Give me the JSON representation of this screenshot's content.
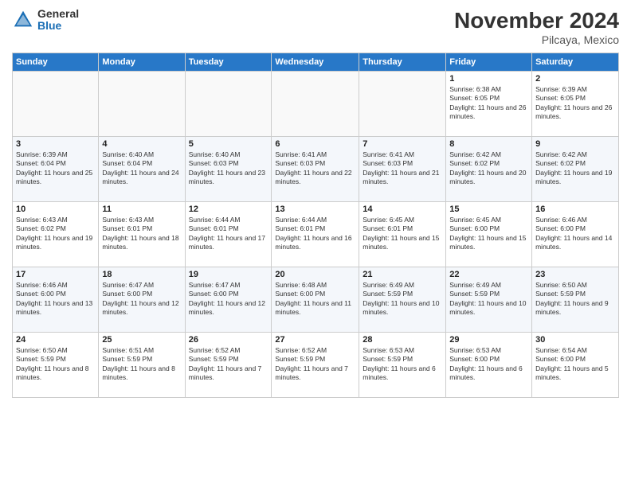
{
  "header": {
    "logo_general": "General",
    "logo_blue": "Blue",
    "month_title": "November 2024",
    "location": "Pilcaya, Mexico"
  },
  "weekdays": [
    "Sunday",
    "Monday",
    "Tuesday",
    "Wednesday",
    "Thursday",
    "Friday",
    "Saturday"
  ],
  "weeks": [
    [
      {
        "day": "",
        "empty": true
      },
      {
        "day": "",
        "empty": true
      },
      {
        "day": "",
        "empty": true
      },
      {
        "day": "",
        "empty": true
      },
      {
        "day": "",
        "empty": true
      },
      {
        "day": "1",
        "sunrise": "Sunrise: 6:38 AM",
        "sunset": "Sunset: 6:05 PM",
        "daylight": "Daylight: 11 hours and 26 minutes."
      },
      {
        "day": "2",
        "sunrise": "Sunrise: 6:39 AM",
        "sunset": "Sunset: 6:05 PM",
        "daylight": "Daylight: 11 hours and 26 minutes."
      }
    ],
    [
      {
        "day": "3",
        "sunrise": "Sunrise: 6:39 AM",
        "sunset": "Sunset: 6:04 PM",
        "daylight": "Daylight: 11 hours and 25 minutes."
      },
      {
        "day": "4",
        "sunrise": "Sunrise: 6:40 AM",
        "sunset": "Sunset: 6:04 PM",
        "daylight": "Daylight: 11 hours and 24 minutes."
      },
      {
        "day": "5",
        "sunrise": "Sunrise: 6:40 AM",
        "sunset": "Sunset: 6:03 PM",
        "daylight": "Daylight: 11 hours and 23 minutes."
      },
      {
        "day": "6",
        "sunrise": "Sunrise: 6:41 AM",
        "sunset": "Sunset: 6:03 PM",
        "daylight": "Daylight: 11 hours and 22 minutes."
      },
      {
        "day": "7",
        "sunrise": "Sunrise: 6:41 AM",
        "sunset": "Sunset: 6:03 PM",
        "daylight": "Daylight: 11 hours and 21 minutes."
      },
      {
        "day": "8",
        "sunrise": "Sunrise: 6:42 AM",
        "sunset": "Sunset: 6:02 PM",
        "daylight": "Daylight: 11 hours and 20 minutes."
      },
      {
        "day": "9",
        "sunrise": "Sunrise: 6:42 AM",
        "sunset": "Sunset: 6:02 PM",
        "daylight": "Daylight: 11 hours and 19 minutes."
      }
    ],
    [
      {
        "day": "10",
        "sunrise": "Sunrise: 6:43 AM",
        "sunset": "Sunset: 6:02 PM",
        "daylight": "Daylight: 11 hours and 19 minutes."
      },
      {
        "day": "11",
        "sunrise": "Sunrise: 6:43 AM",
        "sunset": "Sunset: 6:01 PM",
        "daylight": "Daylight: 11 hours and 18 minutes."
      },
      {
        "day": "12",
        "sunrise": "Sunrise: 6:44 AM",
        "sunset": "Sunset: 6:01 PM",
        "daylight": "Daylight: 11 hours and 17 minutes."
      },
      {
        "day": "13",
        "sunrise": "Sunrise: 6:44 AM",
        "sunset": "Sunset: 6:01 PM",
        "daylight": "Daylight: 11 hours and 16 minutes."
      },
      {
        "day": "14",
        "sunrise": "Sunrise: 6:45 AM",
        "sunset": "Sunset: 6:01 PM",
        "daylight": "Daylight: 11 hours and 15 minutes."
      },
      {
        "day": "15",
        "sunrise": "Sunrise: 6:45 AM",
        "sunset": "Sunset: 6:00 PM",
        "daylight": "Daylight: 11 hours and 15 minutes."
      },
      {
        "day": "16",
        "sunrise": "Sunrise: 6:46 AM",
        "sunset": "Sunset: 6:00 PM",
        "daylight": "Daylight: 11 hours and 14 minutes."
      }
    ],
    [
      {
        "day": "17",
        "sunrise": "Sunrise: 6:46 AM",
        "sunset": "Sunset: 6:00 PM",
        "daylight": "Daylight: 11 hours and 13 minutes."
      },
      {
        "day": "18",
        "sunrise": "Sunrise: 6:47 AM",
        "sunset": "Sunset: 6:00 PM",
        "daylight": "Daylight: 11 hours and 12 minutes."
      },
      {
        "day": "19",
        "sunrise": "Sunrise: 6:47 AM",
        "sunset": "Sunset: 6:00 PM",
        "daylight": "Daylight: 11 hours and 12 minutes."
      },
      {
        "day": "20",
        "sunrise": "Sunrise: 6:48 AM",
        "sunset": "Sunset: 6:00 PM",
        "daylight": "Daylight: 11 hours and 11 minutes."
      },
      {
        "day": "21",
        "sunrise": "Sunrise: 6:49 AM",
        "sunset": "Sunset: 5:59 PM",
        "daylight": "Daylight: 11 hours and 10 minutes."
      },
      {
        "day": "22",
        "sunrise": "Sunrise: 6:49 AM",
        "sunset": "Sunset: 5:59 PM",
        "daylight": "Daylight: 11 hours and 10 minutes."
      },
      {
        "day": "23",
        "sunrise": "Sunrise: 6:50 AM",
        "sunset": "Sunset: 5:59 PM",
        "daylight": "Daylight: 11 hours and 9 minutes."
      }
    ],
    [
      {
        "day": "24",
        "sunrise": "Sunrise: 6:50 AM",
        "sunset": "Sunset: 5:59 PM",
        "daylight": "Daylight: 11 hours and 8 minutes."
      },
      {
        "day": "25",
        "sunrise": "Sunrise: 6:51 AM",
        "sunset": "Sunset: 5:59 PM",
        "daylight": "Daylight: 11 hours and 8 minutes."
      },
      {
        "day": "26",
        "sunrise": "Sunrise: 6:52 AM",
        "sunset": "Sunset: 5:59 PM",
        "daylight": "Daylight: 11 hours and 7 minutes."
      },
      {
        "day": "27",
        "sunrise": "Sunrise: 6:52 AM",
        "sunset": "Sunset: 5:59 PM",
        "daylight": "Daylight: 11 hours and 7 minutes."
      },
      {
        "day": "28",
        "sunrise": "Sunrise: 6:53 AM",
        "sunset": "Sunset: 5:59 PM",
        "daylight": "Daylight: 11 hours and 6 minutes."
      },
      {
        "day": "29",
        "sunrise": "Sunrise: 6:53 AM",
        "sunset": "Sunset: 6:00 PM",
        "daylight": "Daylight: 11 hours and 6 minutes."
      },
      {
        "day": "30",
        "sunrise": "Sunrise: 6:54 AM",
        "sunset": "Sunset: 6:00 PM",
        "daylight": "Daylight: 11 hours and 5 minutes."
      }
    ]
  ]
}
